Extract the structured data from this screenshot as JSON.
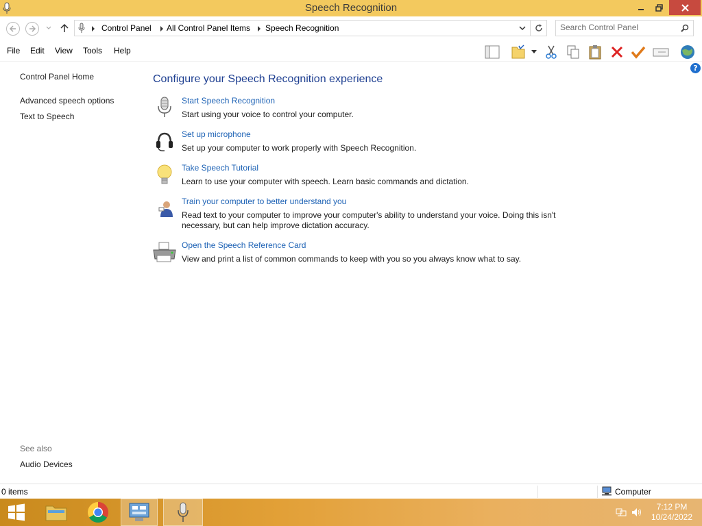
{
  "window": {
    "title": "Speech Recognition"
  },
  "address": {
    "crumbs": [
      "Control Panel",
      "All Control Panel Items",
      "Speech Recognition"
    ],
    "search_placeholder": "Search Control Panel"
  },
  "menu": [
    "File",
    "Edit",
    "View",
    "Tools",
    "Help"
  ],
  "toolbar_icons": [
    "layout-pane-icon",
    "folder-options-icon",
    "cut-icon",
    "copy-icon",
    "paste-icon",
    "delete-icon",
    "properties-check-icon",
    "rename-icon",
    "globe-icon"
  ],
  "left_pane": {
    "home": "Control Panel Home",
    "links": [
      "Advanced speech options",
      "Text to Speech"
    ],
    "see_also_label": "See also",
    "see_also_links": [
      "Audio Devices"
    ]
  },
  "main": {
    "heading": "Configure your Speech Recognition experience",
    "tasks": [
      {
        "icon": "microphone-icon",
        "link": "Start Speech Recognition",
        "desc": "Start using your voice to control your computer."
      },
      {
        "icon": "headset-icon",
        "link": "Set up microphone",
        "desc": "Set up your computer to work properly with Speech Recognition."
      },
      {
        "icon": "lightbulb-icon",
        "link": "Take Speech Tutorial",
        "desc": "Learn to use your computer with speech.  Learn basic commands and dictation."
      },
      {
        "icon": "user-training-icon",
        "link": "Train your computer to better understand you",
        "desc": "Read text to your computer to improve your computer's ability to understand your voice.  Doing this isn't necessary, but can help improve dictation accuracy."
      },
      {
        "icon": "printer-icon",
        "link": "Open the Speech Reference Card",
        "desc": "View and print a list of common commands to keep with you so you always know what to say."
      }
    ]
  },
  "status": {
    "items": "0 items",
    "location": "Computer"
  },
  "taskbar": {
    "time": "7:12 PM",
    "date": "10/24/2022"
  }
}
